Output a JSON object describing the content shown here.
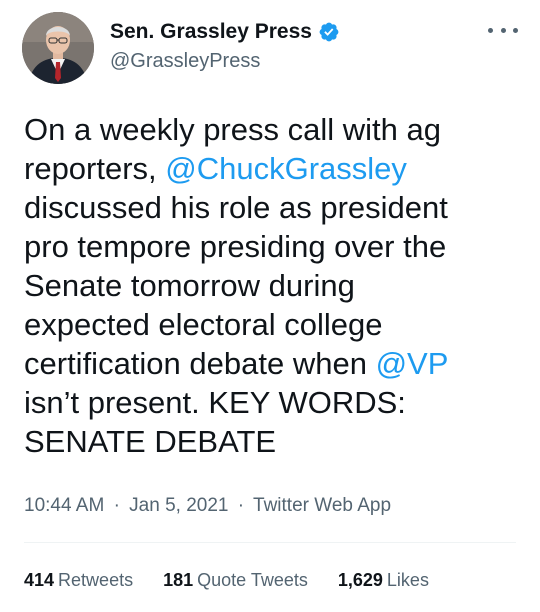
{
  "author": {
    "display_name": "Sen. Grassley Press",
    "handle": "@GrassleyPress",
    "verified": true,
    "avatar": "profile-photo"
  },
  "tweet": {
    "lines": [
      {
        "before": "On a weekly press call with ag",
        "mention": "",
        "after": ""
      },
      {
        "before": "reporters, ",
        "mention": "@ChuckGrassley",
        "after": ""
      },
      {
        "before": "discussed his role as president",
        "mention": "",
        "after": ""
      },
      {
        "before": "pro tempore presiding over the",
        "mention": "",
        "after": ""
      },
      {
        "before": "Senate tomorrow during",
        "mention": "",
        "after": ""
      },
      {
        "before": "expected electoral college",
        "mention": "",
        "after": ""
      },
      {
        "before": "certification debate when ",
        "mention": "@VP",
        "after": ""
      },
      {
        "before": "isn’t present. KEY WORDS:",
        "mention": "",
        "after": ""
      },
      {
        "before": "SENATE DEBATE",
        "mention": "",
        "after": ""
      }
    ]
  },
  "meta": {
    "time": "10:44 AM",
    "date": "Jan 5, 2021",
    "source": "Twitter Web App",
    "separator": "·"
  },
  "stats": {
    "retweets_count": "414",
    "retweets_label": "Retweets",
    "quotes_count": "181",
    "quotes_label": "Quote Tweets",
    "likes_count": "1,629",
    "likes_label": "Likes"
  },
  "colors": {
    "text": "#0f1419",
    "secondary": "#536471",
    "link": "#1d9bf0",
    "divider": "#eff3f4"
  },
  "icons": {
    "verified": "verified-badge-icon",
    "more": "more-options-icon"
  }
}
